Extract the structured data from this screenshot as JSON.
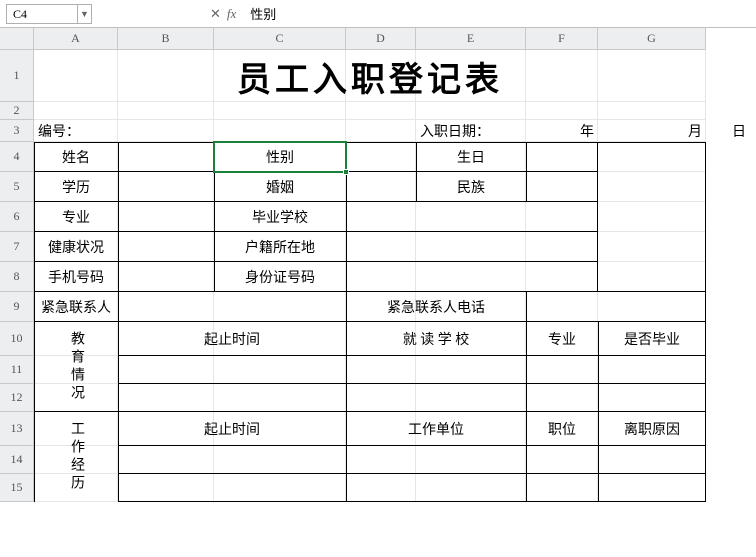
{
  "nameBox": "C4",
  "fxValue": "性别",
  "columns": [
    "A",
    "B",
    "C",
    "D",
    "E",
    "F",
    "G"
  ],
  "rows": [
    "1",
    "2",
    "3",
    "4",
    "5",
    "6",
    "7",
    "8",
    "9",
    "10",
    "11",
    "12",
    "13",
    "14",
    "15"
  ],
  "title": "员工入职登记表",
  "row3": {
    "bianhao": "编号：",
    "ruzhi": "入职日期：",
    "nian": "年",
    "yue": "月",
    "ri": "日"
  },
  "labels": {
    "r4": {
      "a": "姓名",
      "c": "性别",
      "e": "生日"
    },
    "r5": {
      "a": "学历",
      "c": "婚姻",
      "e": "民族"
    },
    "r6": {
      "a": "专业",
      "c": "毕业学校"
    },
    "r7": {
      "a": "健康状况",
      "c": "户籍所在地"
    },
    "r8": {
      "a": "手机号码",
      "c": "身份证号码"
    },
    "r9": {
      "a": "紧急联系人",
      "d": "紧急联系人电话"
    },
    "edu": {
      "a": "教育情况",
      "bc": "起止时间",
      "de": "就 读 学 校",
      "f": "专业",
      "g": "是否毕业"
    },
    "work": {
      "a": "工作经历",
      "bc": "起止时间",
      "de": "工作单位",
      "f": "职位",
      "g": "离职原因"
    }
  }
}
